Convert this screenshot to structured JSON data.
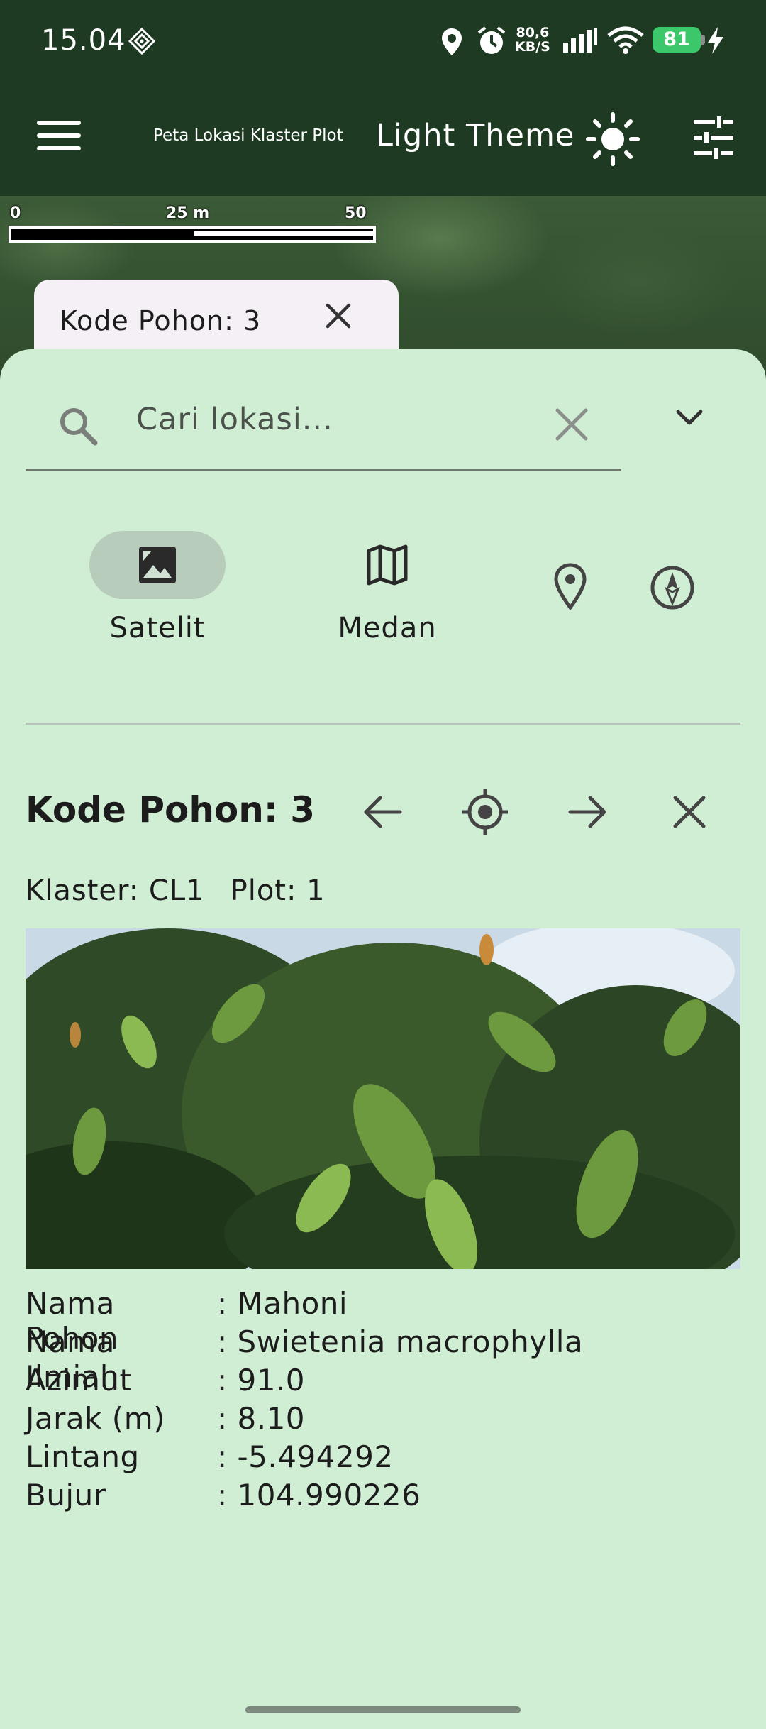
{
  "status_bar": {
    "time": "15.04",
    "net_speed_value": "80,6",
    "net_speed_unit": "KB/S",
    "battery_level": "81"
  },
  "app_bar": {
    "title": "Peta Lokasi Klaster Plot",
    "theme_label": "Light Theme"
  },
  "map": {
    "scale_labels": [
      "0",
      "25 m",
      "50 m"
    ],
    "chip_label": "Kode Pohon: 3"
  },
  "search": {
    "placeholder": "Cari lokasi...",
    "value": ""
  },
  "map_types": [
    {
      "label": "Satelit",
      "selected": true
    },
    {
      "label": "Medan",
      "selected": false
    }
  ],
  "detail": {
    "title": "Kode Pohon: 3",
    "cluster": "Klaster: CL1",
    "plot": "Plot: 1",
    "fields": [
      {
        "key": "Nama Pohon",
        "value": ": Mahoni"
      },
      {
        "key": "Nama Ilmiah",
        "value": ": Swietenia macrophylla"
      },
      {
        "key": "Azimut",
        "value": ": 91.0"
      },
      {
        "key": "Jarak (m)",
        "value": ": 8.10"
      },
      {
        "key": "Lintang",
        "value": ": -5.494292"
      },
      {
        "key": "Bujur",
        "value": ": 104.990226"
      }
    ]
  },
  "colors": {
    "app_bar": "#1e3a22",
    "sheet": "#d0eed4",
    "selected_pill": "#b8ccbb",
    "battery": "#3cc76a"
  },
  "icons": [
    "diamond-icon",
    "location-icon",
    "alarm-icon",
    "signal-icon",
    "wifi-icon",
    "charging-icon",
    "menu-icon",
    "sun-icon",
    "tune-icon",
    "close-icon",
    "search-icon",
    "chevron-down-icon",
    "image-icon",
    "map-icon",
    "pin-icon",
    "compass-icon",
    "arrow-left-icon",
    "gps-icon",
    "arrow-right-icon"
  ]
}
